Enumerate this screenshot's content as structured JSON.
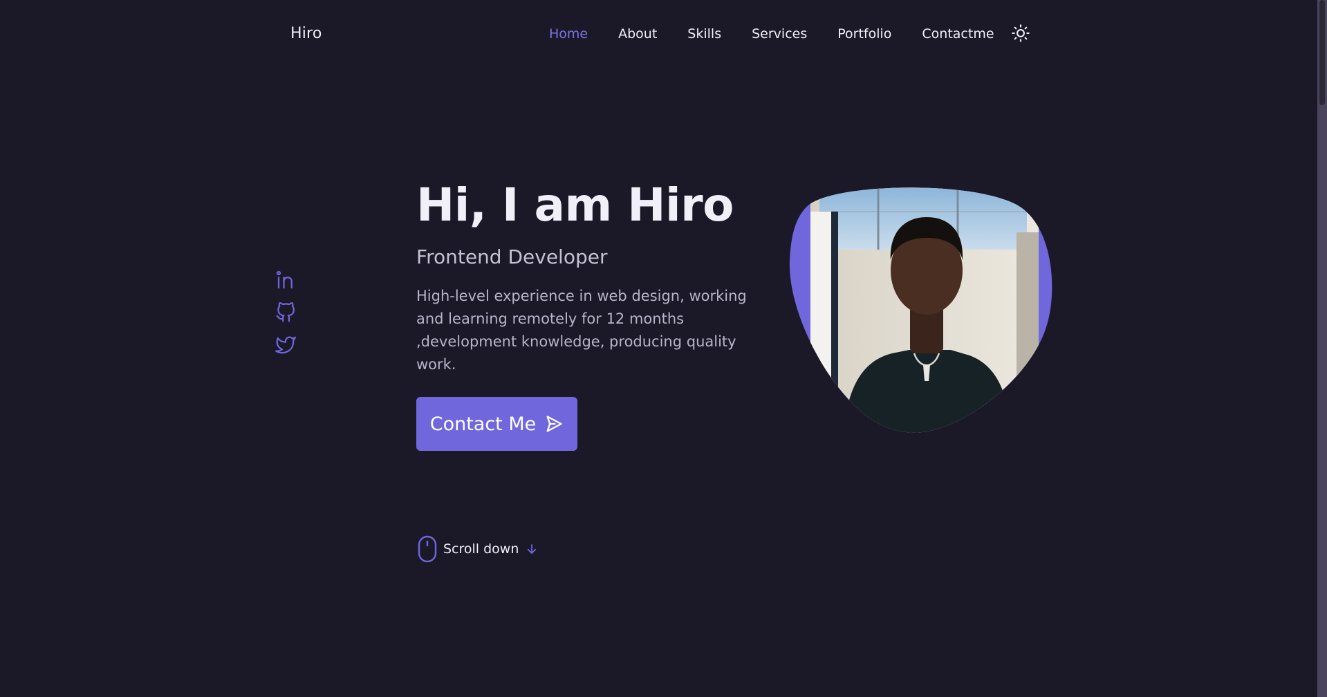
{
  "header": {
    "logo": "Hiro",
    "nav": [
      {
        "label": "Home",
        "active": true
      },
      {
        "label": "About",
        "active": false
      },
      {
        "label": "Skills",
        "active": false
      },
      {
        "label": "Services",
        "active": false
      },
      {
        "label": "Portfolio",
        "active": false
      },
      {
        "label": "Contactme",
        "active": false
      }
    ],
    "theme_icon": "sun-icon"
  },
  "social": {
    "links": [
      "linkedin-icon",
      "github-icon",
      "twitter-icon"
    ]
  },
  "hero": {
    "title": "Hi, I am Hiro",
    "subtitle": "Frontend Developer",
    "description": "High-level experience in web design, working and learning remotely for 12 months ,development knowledge, producing quality work.",
    "button_label": "Contact Me",
    "button_icon": "send-icon"
  },
  "scroll": {
    "label": "Scroll down",
    "mouse_icon": "mouse-icon",
    "arrow_icon": "arrow-down-icon"
  },
  "colors": {
    "background": "#1b1828",
    "accent": "#6f67db",
    "text": "#f1eff7",
    "muted_text": "#b9b5c9"
  }
}
